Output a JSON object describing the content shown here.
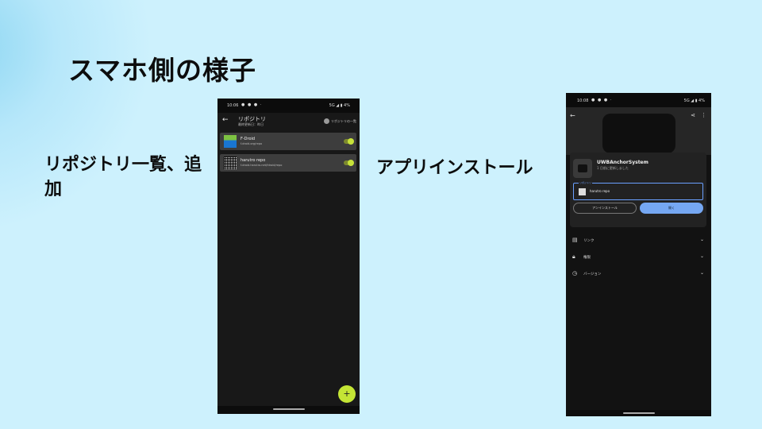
{
  "slide": {
    "title": "スマホ側の様子",
    "caption_left": "リポジトリ一覧、追加",
    "caption_right": "アプリインストール"
  },
  "phone1": {
    "status": {
      "time": "10:06",
      "right": "5G ◢ ▮ 4%"
    },
    "appbar": {
      "back_icon": "arrow-left-icon",
      "title": "リポジトリ",
      "subtitle": "最終更新日：昨日",
      "list_button": "リポジトリの一覧"
    },
    "repos": [
      {
        "name": "F-Droid",
        "url": "f-droid.org/repo",
        "enabled": true
      },
      {
        "name": "harutro repo",
        "url": "f-droid.harutro.net/fdroid/repo",
        "enabled": true
      }
    ],
    "fab_label": "+"
  },
  "phone2": {
    "status": {
      "time": "10:08",
      "right": "5G ◢ ▮ 4%"
    },
    "app": {
      "name": "UWBAnchorSystem",
      "subtitle": "1 日前に更新しました"
    },
    "repo_field": {
      "legend": "リポジトリ",
      "value": "harutro repo"
    },
    "buttons": {
      "uninstall": "アンインストール",
      "open": "開く"
    },
    "sections": [
      {
        "icon": "link-icon",
        "label": "リンク"
      },
      {
        "icon": "lock-icon",
        "label": "権限"
      },
      {
        "icon": "history-icon",
        "label": "バージョン"
      }
    ]
  }
}
